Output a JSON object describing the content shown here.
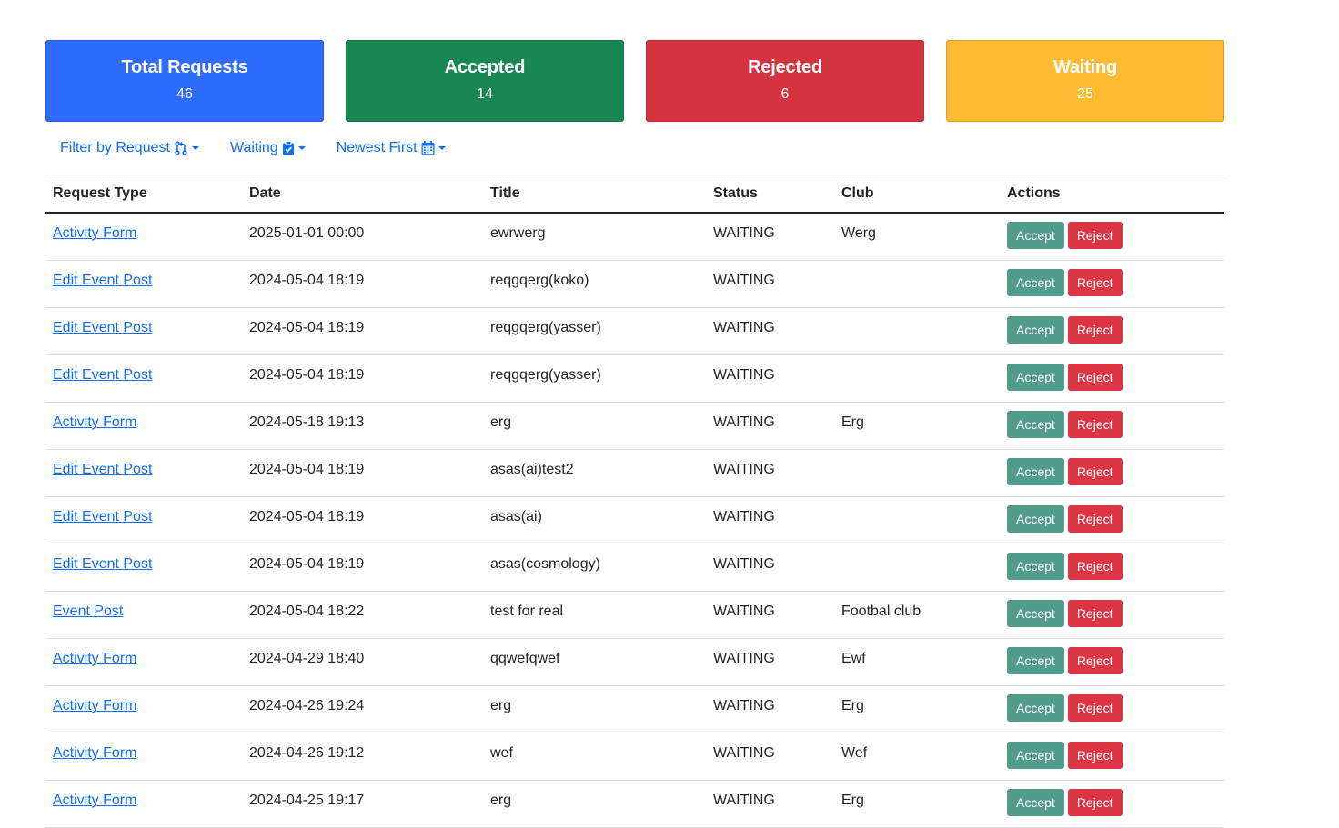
{
  "stats": [
    {
      "title": "Total Requests",
      "value": "46",
      "color": "#2f6bfc"
    },
    {
      "title": "Accepted",
      "value": "14",
      "color": "#198754"
    },
    {
      "title": "Rejected",
      "value": "6",
      "color": "#d63340"
    },
    {
      "title": "Waiting",
      "value": "25",
      "color": "#fdbb34"
    }
  ],
  "filters": {
    "request_label": "Filter by Request",
    "status_label": "Waiting",
    "sort_label": "Newest First"
  },
  "table": {
    "headers": [
      "Request Type",
      "Date",
      "Title",
      "Status",
      "Club",
      "Actions"
    ],
    "accept_label": "Accept",
    "reject_label": "Reject",
    "rows": [
      {
        "type": "Activity Form",
        "date": "2025-01-01 00:00",
        "title": "ewrwerg",
        "status": "WAITING",
        "club": "Werg"
      },
      {
        "type": "Edit Event Post",
        "date": "2024-05-04 18:19",
        "title": "reqgqerg(koko)",
        "status": "WAITING",
        "club": ""
      },
      {
        "type": "Edit Event Post",
        "date": "2024-05-04 18:19",
        "title": "reqgqerg(yasser)",
        "status": "WAITING",
        "club": ""
      },
      {
        "type": "Edit Event Post",
        "date": "2024-05-04 18:19",
        "title": "reqgqerg(yasser)",
        "status": "WAITING",
        "club": ""
      },
      {
        "type": "Activity Form",
        "date": "2024-05-18 19:13",
        "title": "erg",
        "status": "WAITING",
        "club": "Erg"
      },
      {
        "type": "Edit Event Post",
        "date": "2024-05-04 18:19",
        "title": "asas(ai)test2",
        "status": "WAITING",
        "club": ""
      },
      {
        "type": "Edit Event Post",
        "date": "2024-05-04 18:19",
        "title": "asas(ai)",
        "status": "WAITING",
        "club": ""
      },
      {
        "type": "Edit Event Post",
        "date": "2024-05-04 18:19",
        "title": "asas(cosmology)",
        "status": "WAITING",
        "club": ""
      },
      {
        "type": "Event Post",
        "date": "2024-05-04 18:22",
        "title": "test for real",
        "status": "WAITING",
        "club": "Footbal club"
      },
      {
        "type": "Activity Form",
        "date": "2024-04-29 18:40",
        "title": "qqwefqwef",
        "status": "WAITING",
        "club": "Ewf"
      },
      {
        "type": "Activity Form",
        "date": "2024-04-26 19:24",
        "title": "erg",
        "status": "WAITING",
        "club": "Erg"
      },
      {
        "type": "Activity Form",
        "date": "2024-04-26 19:12",
        "title": "wef",
        "status": "WAITING",
        "club": "Wef"
      },
      {
        "type": "Activity Form",
        "date": "2024-04-25 19:17",
        "title": "erg",
        "status": "WAITING",
        "club": "Erg"
      }
    ]
  }
}
